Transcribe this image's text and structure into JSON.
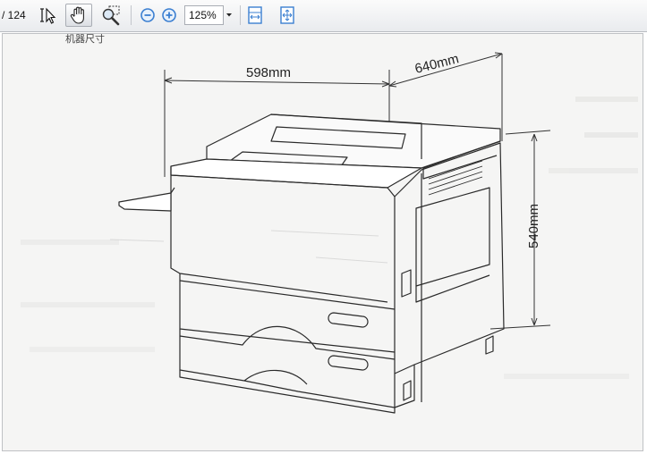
{
  "toolbar": {
    "page_count": "/ 124",
    "zoom_value": "125%",
    "icons": {
      "select": "text-select-icon",
      "hand": "hand-tool-icon",
      "marquee_zoom": "marquee-zoom-icon",
      "zoom_out": "zoom-out-icon",
      "zoom_in": "zoom-in-icon",
      "zoom_dropdown": "chevron-down-icon",
      "fit_width": "fit-width-icon",
      "fit_page": "fit-page-icon"
    },
    "colors": {
      "accent": "#3b7fd1",
      "active_bg": "#dcdfe4"
    }
  },
  "document": {
    "stray_text": "机器尺寸",
    "dimensions": {
      "width_label": "598mm",
      "depth_label": "640mm",
      "height_label": "540mm"
    }
  }
}
